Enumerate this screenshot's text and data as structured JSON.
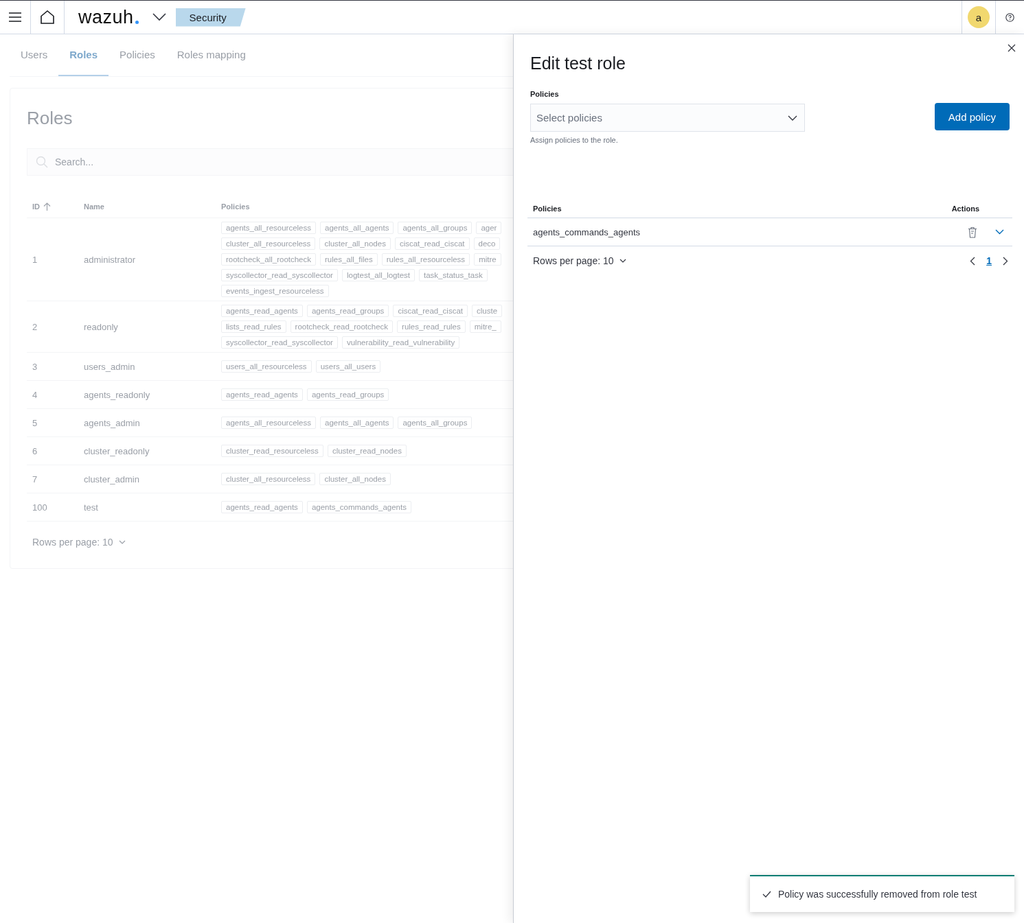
{
  "header": {
    "logo": "wazuh",
    "breadcrumb": "Security",
    "avatar": "a"
  },
  "tabs": [
    {
      "label": "Users",
      "selected": false
    },
    {
      "label": "Roles",
      "selected": true
    },
    {
      "label": "Policies",
      "selected": false
    },
    {
      "label": "Roles mapping",
      "selected": false
    }
  ],
  "roles_panel": {
    "title": "Roles",
    "search": {
      "placeholder": "Search..."
    },
    "columns": [
      {
        "label": "ID",
        "sort_ascending": true
      },
      {
        "label": "Name"
      },
      {
        "label": "Policies"
      }
    ],
    "rows": [
      {
        "id": "1",
        "name": "administrator",
        "policy_lines": [
          [
            "agents_all_resourceless",
            "agents_all_agents",
            "agents_all_groups",
            "ager"
          ],
          [
            "cluster_all_resourceless",
            "cluster_all_nodes",
            "ciscat_read_ciscat",
            "deco"
          ],
          [
            "rootcheck_all_rootcheck",
            "rules_all_files",
            "rules_all_resourceless",
            "mitre"
          ],
          [
            "syscollector_read_syscollector",
            "logtest_all_logtest",
            "task_status_task"
          ],
          [
            "events_ingest_resourceless"
          ]
        ]
      },
      {
        "id": "2",
        "name": "readonly",
        "policy_lines": [
          [
            "agents_read_agents",
            "agents_read_groups",
            "ciscat_read_ciscat",
            "cluste"
          ],
          [
            "lists_read_rules",
            "rootcheck_read_rootcheck",
            "rules_read_rules",
            "mitre_"
          ],
          [
            "syscollector_read_syscollector",
            "vulnerability_read_vulnerability"
          ]
        ]
      },
      {
        "id": "3",
        "name": "users_admin",
        "policy_lines": [
          [
            "users_all_resourceless",
            "users_all_users"
          ]
        ]
      },
      {
        "id": "4",
        "name": "agents_readonly",
        "policy_lines": [
          [
            "agents_read_agents",
            "agents_read_groups"
          ]
        ]
      },
      {
        "id": "5",
        "name": "agents_admin",
        "policy_lines": [
          [
            "agents_all_resourceless",
            "agents_all_agents",
            "agents_all_groups"
          ]
        ]
      },
      {
        "id": "6",
        "name": "cluster_readonly",
        "policy_lines": [
          [
            "cluster_read_resourceless",
            "cluster_read_nodes"
          ]
        ]
      },
      {
        "id": "7",
        "name": "cluster_admin",
        "policy_lines": [
          [
            "cluster_all_resourceless",
            "cluster_all_nodes"
          ]
        ]
      },
      {
        "id": "100",
        "name": "test",
        "policy_lines": [
          [
            "agents_read_agents",
            "agents_commands_agents"
          ]
        ]
      }
    ],
    "rows_per_page": "Rows per page: 10"
  },
  "flyout": {
    "title": "Edit test role",
    "field_label": "Policies",
    "select": {
      "placeholder": "Select policies"
    },
    "help": "Assign policies to the role.",
    "add_button": "Add policy",
    "columns": [
      {
        "label": "Policies"
      },
      {
        "label": "Actions"
      }
    ],
    "rows": [
      {
        "policy": "agents_commands_agents"
      }
    ],
    "rows_per_page": "Rows per page: 10",
    "pages": [
      {
        "label": "1",
        "selected": true
      }
    ]
  },
  "toast": {
    "message": "Policy was successfully removed from role test"
  }
}
